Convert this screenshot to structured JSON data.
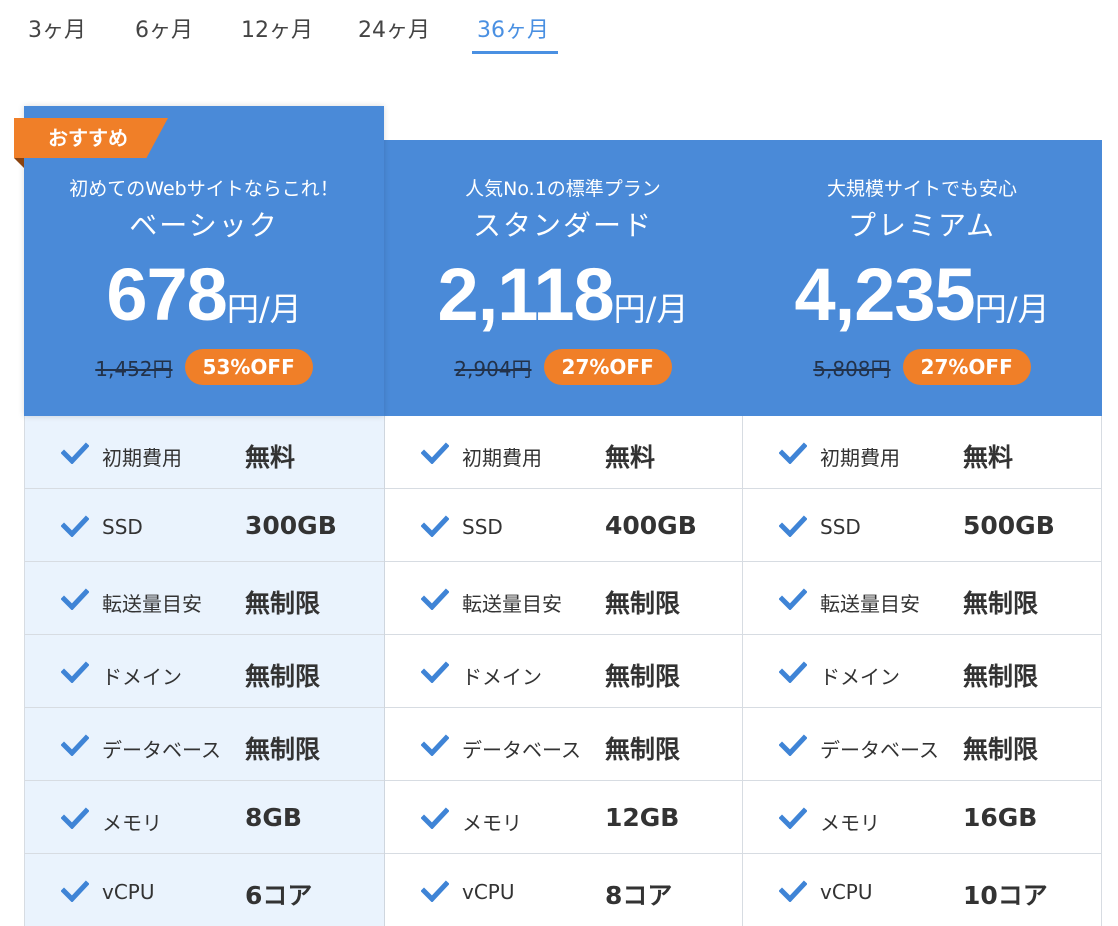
{
  "tabs": [
    {
      "label": "3ヶ月"
    },
    {
      "label": "6ヶ月"
    },
    {
      "label": "12ヶ月"
    },
    {
      "label": "24ヶ月"
    },
    {
      "label": "36ヶ月"
    }
  ],
  "active_tab": "36ヶ月",
  "colors": {
    "accent": "#4a90e2",
    "header_blue": "#4a8ad8",
    "orange": "#f07f28",
    "basic_bg": "#eaf3fd"
  },
  "recommend_badge": "おすすめ",
  "plans": [
    {
      "tagline": "初めてのWebサイトならこれ！",
      "name": "ベーシック",
      "price": "678",
      "unit": "円/月",
      "original": "1,452円",
      "discount": "53%OFF",
      "features": [
        {
          "label": "初期費用",
          "value": "無料"
        },
        {
          "label": "SSD",
          "value": "300GB"
        },
        {
          "label": "転送量目安",
          "value": "無制限"
        },
        {
          "label": "ドメイン",
          "value": "無制限"
        },
        {
          "label": "データベース",
          "value": "無制限"
        },
        {
          "label": "メモリ",
          "value": "8GB"
        },
        {
          "label": "vCPU",
          "value": "6コア"
        }
      ]
    },
    {
      "tagline": "人気No.1の標準プラン",
      "name": "スタンダード",
      "price": "2,118",
      "unit": "円/月",
      "original": "2,904円",
      "discount": "27%OFF",
      "features": [
        {
          "label": "初期費用",
          "value": "無料"
        },
        {
          "label": "SSD",
          "value": "400GB"
        },
        {
          "label": "転送量目安",
          "value": "無制限"
        },
        {
          "label": "ドメイン",
          "value": "無制限"
        },
        {
          "label": "データベース",
          "value": "無制限"
        },
        {
          "label": "メモリ",
          "value": "12GB"
        },
        {
          "label": "vCPU",
          "value": "8コア"
        }
      ]
    },
    {
      "tagline": "大規模サイトでも安心",
      "name": "プレミアム",
      "price": "4,235",
      "unit": "円/月",
      "original": "5,808円",
      "discount": "27%OFF",
      "features": [
        {
          "label": "初期費用",
          "value": "無料"
        },
        {
          "label": "SSD",
          "value": "500GB"
        },
        {
          "label": "転送量目安",
          "value": "無制限"
        },
        {
          "label": "ドメイン",
          "value": "無制限"
        },
        {
          "label": "データベース",
          "value": "無制限"
        },
        {
          "label": "メモリ",
          "value": "16GB"
        },
        {
          "label": "vCPU",
          "value": "10コア"
        }
      ]
    }
  ]
}
